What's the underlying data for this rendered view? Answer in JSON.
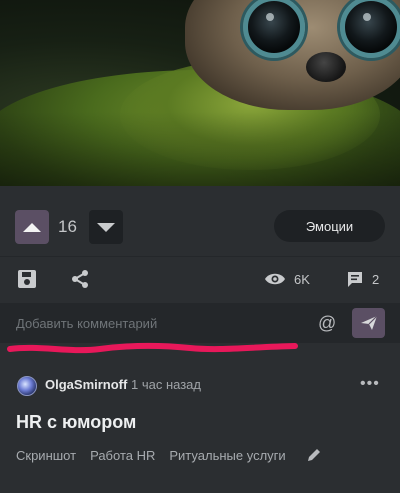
{
  "hero": {
    "image_icon": "creature-image"
  },
  "votes": {
    "score": "16",
    "emotions_label": "Эмоции"
  },
  "actions": {
    "views": "6K",
    "comments": "2"
  },
  "comment": {
    "placeholder": "Добавить комментарий",
    "at_symbol": "@"
  },
  "post": {
    "author": "OlgaSmirnoff",
    "time": "1 час назад",
    "more": "•••",
    "title": "HR с юмором",
    "tags": [
      "Скриншот",
      "Работа HR",
      "Ритуальные услуги"
    ]
  },
  "colors": {
    "accent": "#5b4f64",
    "background": "#2b2e31",
    "annotation_red": "#e8185a"
  }
}
